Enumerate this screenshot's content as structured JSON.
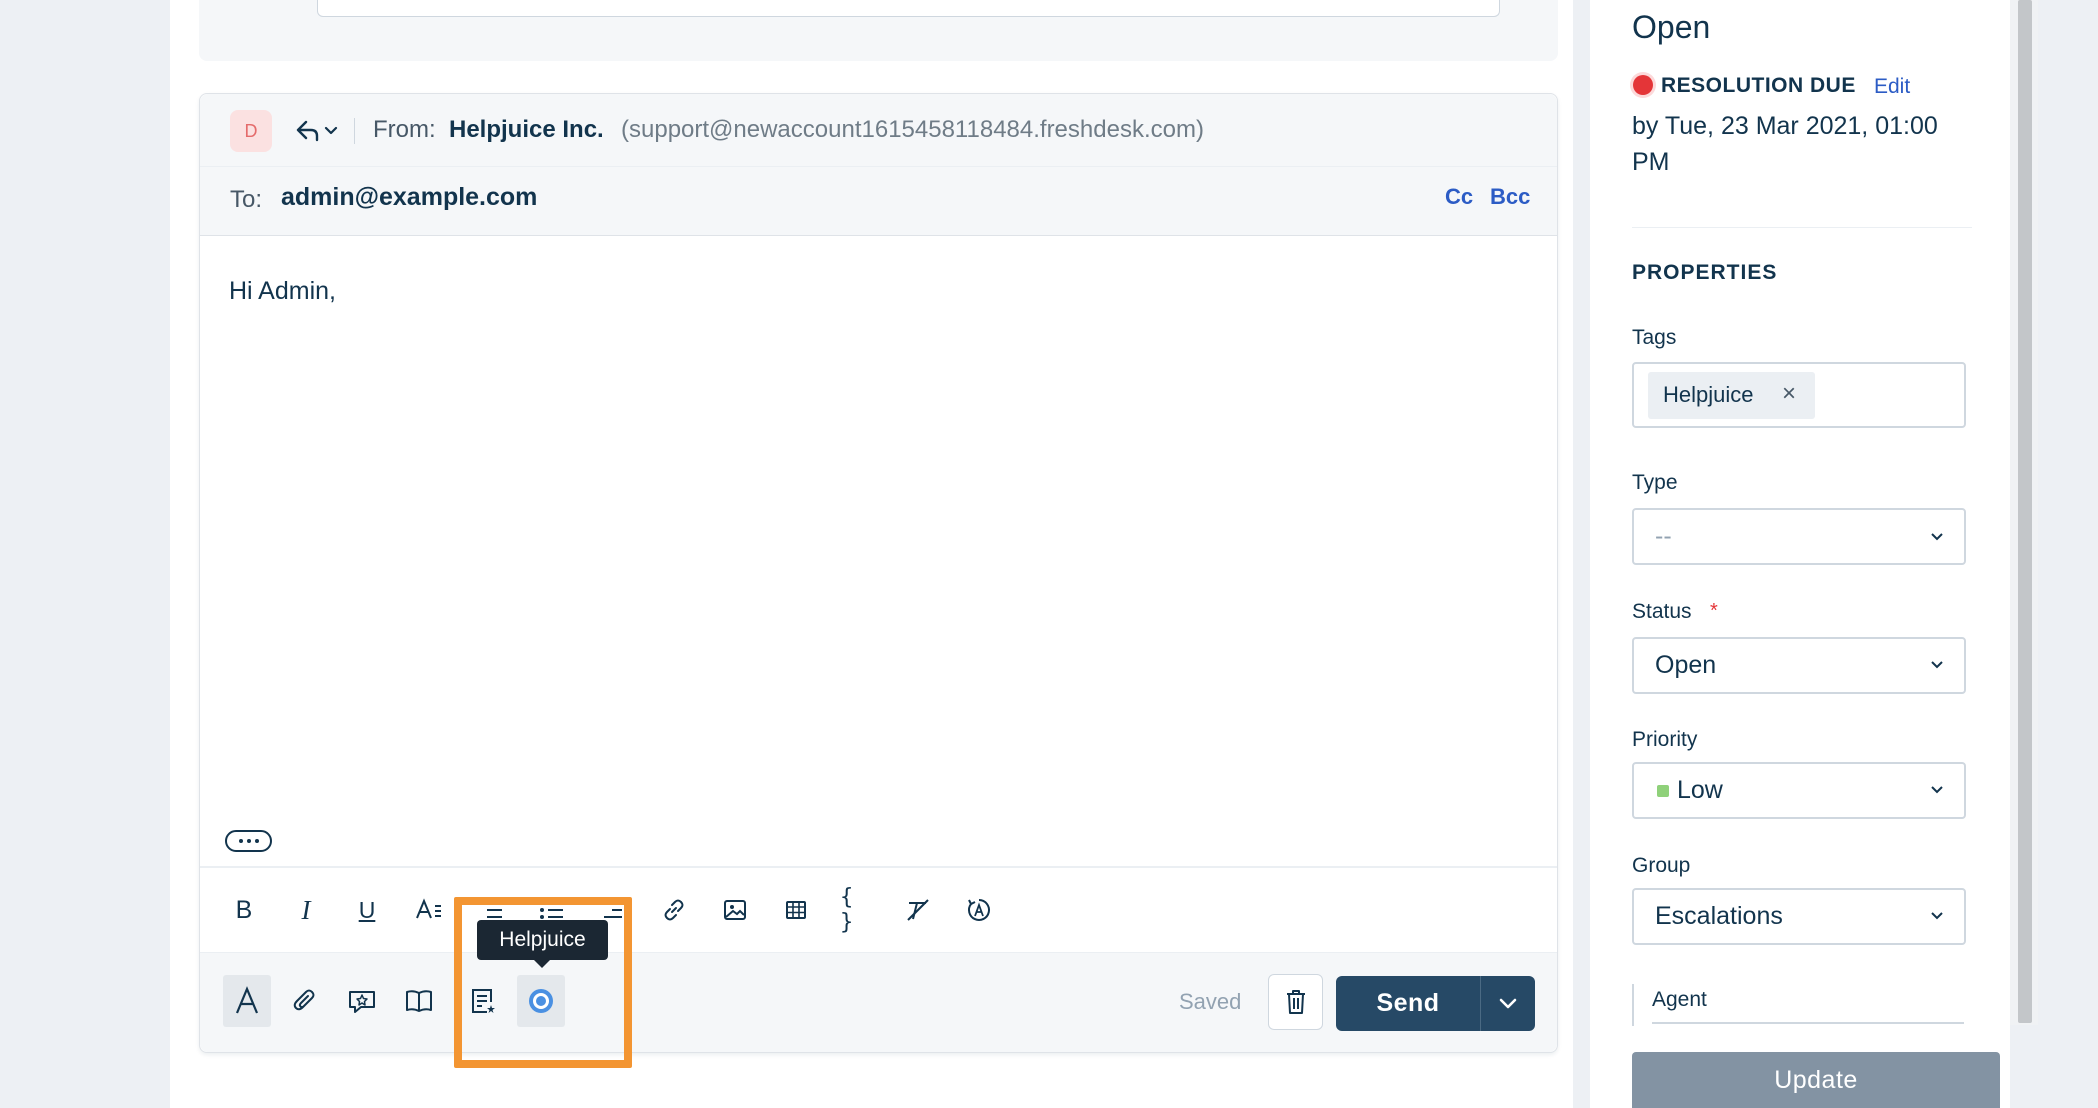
{
  "reply": {
    "avatar_letter": "D",
    "from_label": "From:",
    "from_name": "Helpjuice Inc.",
    "from_email": "(support@newaccount1615458118484.freshdesk.com)",
    "to_label": "To:",
    "to_value": "admin@example.com",
    "cc_label": "Cc",
    "bcc_label": "Bcc",
    "body_text": "Hi Admin,"
  },
  "toolbar": {
    "format_buttons": [
      "bold-icon",
      "italic-icon",
      "underline-icon",
      "font-size-icon",
      "ordered-list-icon",
      "unordered-list-icon",
      "indent-icon",
      "link-icon",
      "image-icon",
      "table-icon",
      "code-braces-icon",
      "clear-format-icon",
      "spellcheck-icon"
    ],
    "bold_glyph": "B",
    "italic_glyph": "I",
    "underline_glyph": "U",
    "code_glyph": "{ }",
    "tooltip": "Helpjuice"
  },
  "footer": {
    "saved_label": "Saved",
    "send_label": "Send"
  },
  "sidebar": {
    "status_heading": "Open",
    "resolution_due_label": "RESOLUTION DUE",
    "edit_label": "Edit",
    "due_date": "by Tue, 23 Mar 2021, 01:00 PM",
    "properties_label": "PROPERTIES",
    "tags_label": "Tags",
    "tag_value": "Helpjuice",
    "tag_remove": "×",
    "type_label": "Type",
    "type_value": "--",
    "status_label": "Status",
    "status_required": "*",
    "status_value": "Open",
    "priority_label": "Priority",
    "priority_value": "Low",
    "priority_color": "#8fd17a",
    "group_label": "Group",
    "group_value": "Escalations",
    "agent_label": "Agent",
    "update_label": "Update"
  },
  "colors": {
    "accent_link": "#2c5cc5",
    "send_button": "#264966",
    "highlight": "#f39532",
    "due_dot": "#e43538"
  }
}
